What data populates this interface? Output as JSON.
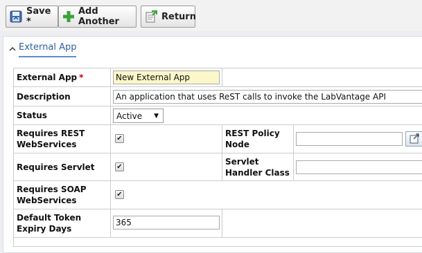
{
  "toolbar": {
    "save_label": "Save *",
    "add_another_label": "Add Another",
    "return_label": "Return"
  },
  "section": {
    "title": "External App"
  },
  "form": {
    "external_app": {
      "label": "External App",
      "required_mark": "*",
      "value": "New External App"
    },
    "description": {
      "label": "Description",
      "value": "An application that uses ReST calls to invoke the LabVantage API"
    },
    "status": {
      "label": "Status",
      "value": "Active"
    },
    "requires_rest": {
      "label": "Requires REST WebServices",
      "checked": true
    },
    "requires_servlet": {
      "label": "Requires Servlet",
      "checked": true
    },
    "requires_soap": {
      "label": "Requires SOAP WebServices",
      "checked": true
    },
    "token_expiry": {
      "label": "Default Token Expiry Days",
      "value": "365"
    },
    "rest_policy_node": {
      "label": "REST Policy Node",
      "value": ""
    },
    "servlet_handler_class": {
      "label": "Servlet Handler Class",
      "value": ""
    }
  },
  "icons": {
    "save": "save-icon",
    "add": "plus-icon",
    "return": "return-icon",
    "collapse": "chevron-up-icon",
    "lookup": "open-lookup-icon"
  },
  "colors": {
    "section_title": "#2f5f9a",
    "required": "#c00000",
    "add_green": "#3aa33a",
    "highlight_input": "#fbf7c9"
  }
}
